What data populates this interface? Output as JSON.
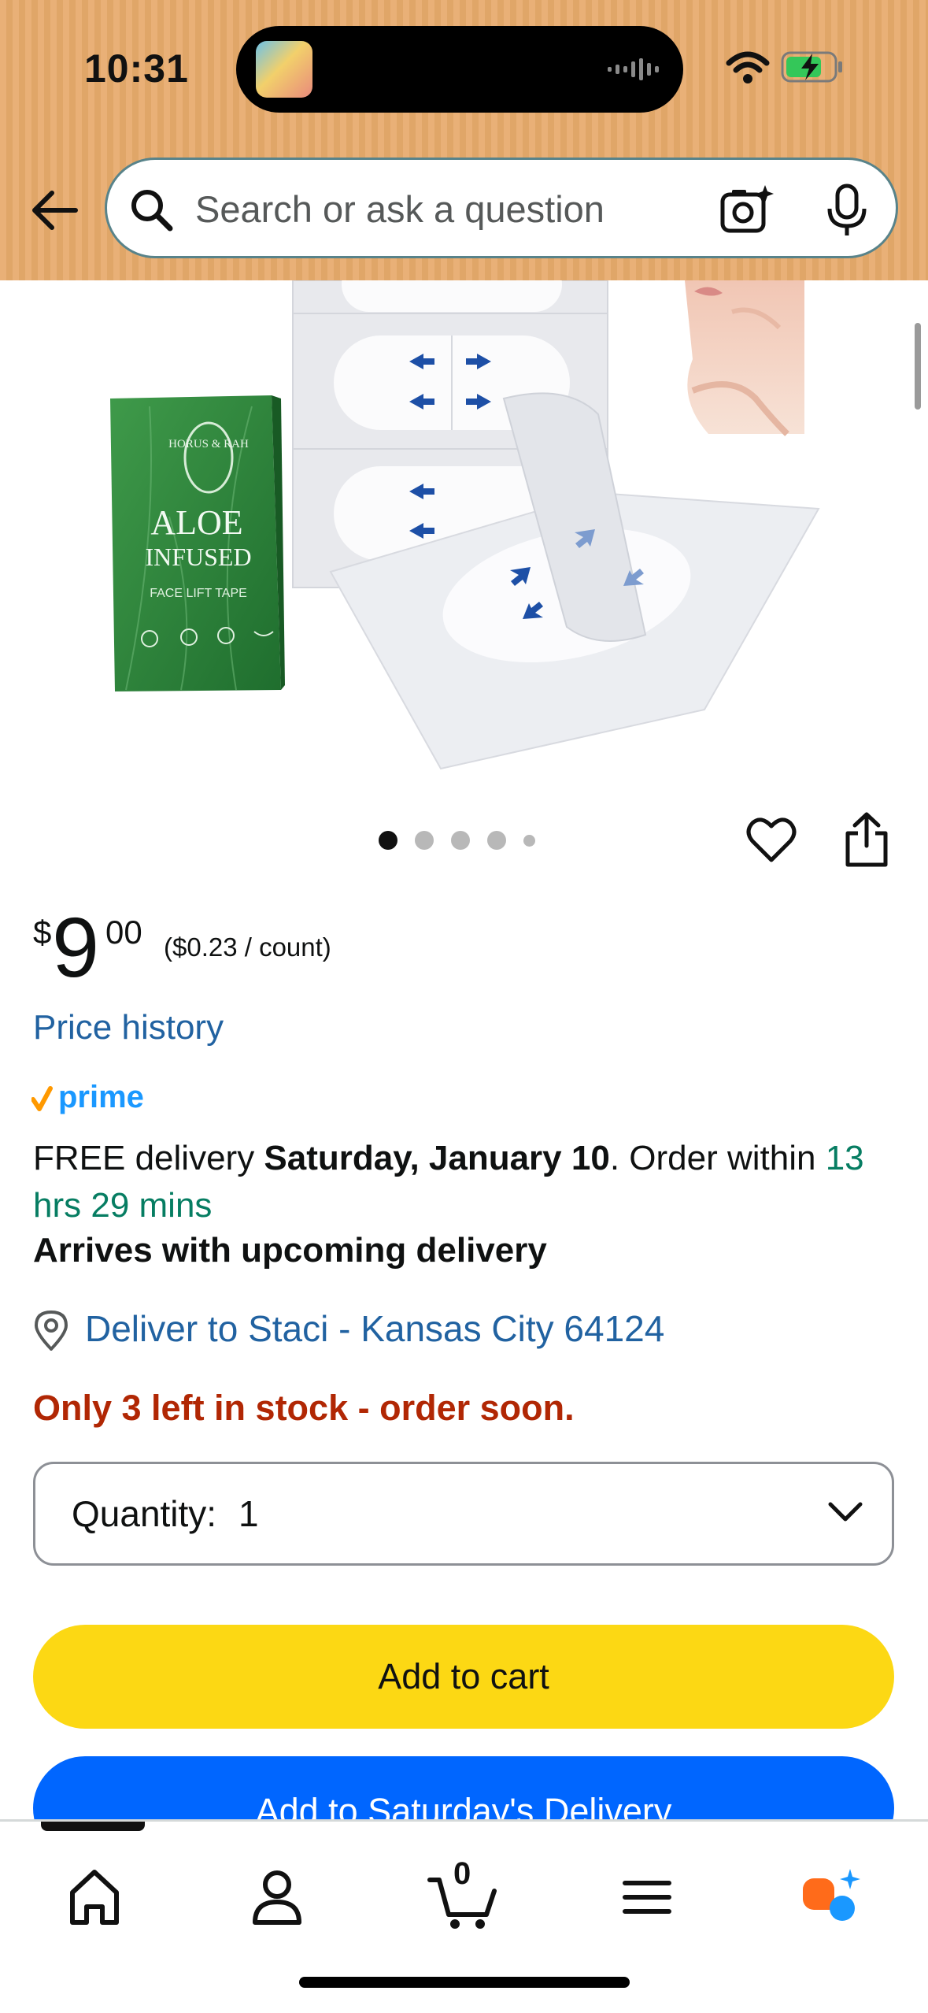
{
  "status_bar": {
    "time": "10:31"
  },
  "search": {
    "placeholder": "Search or ask a question"
  },
  "product_image": {
    "box_brand": "HORUS & RAH",
    "box_title_line1": "ALOE",
    "box_title_line2": "INFUSED",
    "box_subtitle": "FACE LIFT TAPE"
  },
  "gallery": {
    "image_count": 5,
    "active_index": 0
  },
  "price": {
    "symbol": "$",
    "whole": "9",
    "fraction": "00",
    "unit_price": "($0.23 / count)"
  },
  "price_history_label": "Price history",
  "prime_label": "prime",
  "delivery": {
    "prefix": "FREE delivery ",
    "date": "Saturday, January 10",
    "middle": ". Order within ",
    "countdown": "13 hrs 29 mins",
    "upcoming": "Arrives with upcoming delivery"
  },
  "deliver_to": "Deliver to Staci - Kansas City 64124",
  "stock": "Only 3 left in stock - order soon.",
  "quantity": {
    "label": "Quantity:",
    "value": "1"
  },
  "buttons": {
    "add_to_cart": "Add to cart",
    "add_to_delivery": "Add to Saturday's Delivery"
  },
  "tabbar": {
    "cart_count": "0"
  },
  "colors": {
    "header_bg": "#e9b077",
    "link": "#2162a1",
    "green": "#067d62",
    "stock_red": "#b12704",
    "cart_yellow": "#fcd814",
    "delivery_blue": "#0066ff",
    "prime_blue": "#1a98ff",
    "prime_check": "#f90"
  }
}
